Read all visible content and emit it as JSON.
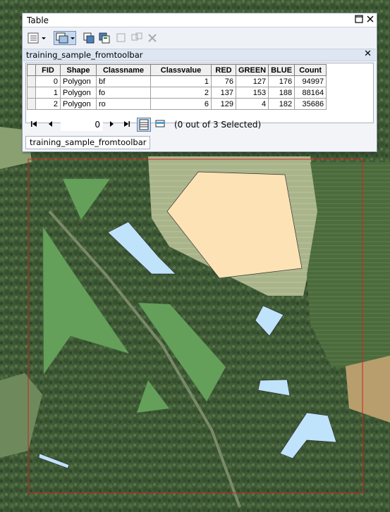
{
  "window": {
    "title": "Table"
  },
  "table_tab": {
    "name": "training_sample_fromtoolbar",
    "bottom_tab": "training_sample_fromtoolbar"
  },
  "columns": [
    "FID",
    "Shape",
    "Classname",
    "Classvalue",
    "RED",
    "GREEN",
    "BLUE",
    "Count"
  ],
  "rows": [
    {
      "FID": "0",
      "Shape": "Polygon",
      "Classname": "bf",
      "Classvalue": "1",
      "RED": "76",
      "GREEN": "127",
      "BLUE": "176",
      "Count": "94997"
    },
    {
      "FID": "1",
      "Shape": "Polygon",
      "Classname": "fo",
      "Classvalue": "2",
      "RED": "137",
      "GREEN": "153",
      "BLUE": "188",
      "Count": "88164"
    },
    {
      "FID": "2",
      "Shape": "Polygon",
      "Classname": "ro",
      "Classvalue": "6",
      "RED": "129",
      "GREEN": "4",
      "BLUE": "182",
      "Count": "35686"
    }
  ],
  "navigation": {
    "current_record": "0",
    "selection_text": "(0 out of 3 Selected)"
  },
  "icons": {
    "table_options": "table-options-icon",
    "related_tables": "related-tables-icon",
    "select_by_attributes": "select-by-attributes-icon",
    "switch_selection": "switch-selection-icon",
    "clear_selection": "clear-selection-icon",
    "zoom_to_selected": "zoom-to-selected-icon",
    "delete_selected": "delete-selected-icon",
    "show_all_records": "show-all-records-icon",
    "show_selected_records": "show-selected-records-icon"
  },
  "map": {
    "colors": {
      "forest_class": "#65a05b",
      "water_class": "#bfe3fb",
      "field_class": "#fde2b5",
      "extent_outline": "#d42020"
    }
  }
}
